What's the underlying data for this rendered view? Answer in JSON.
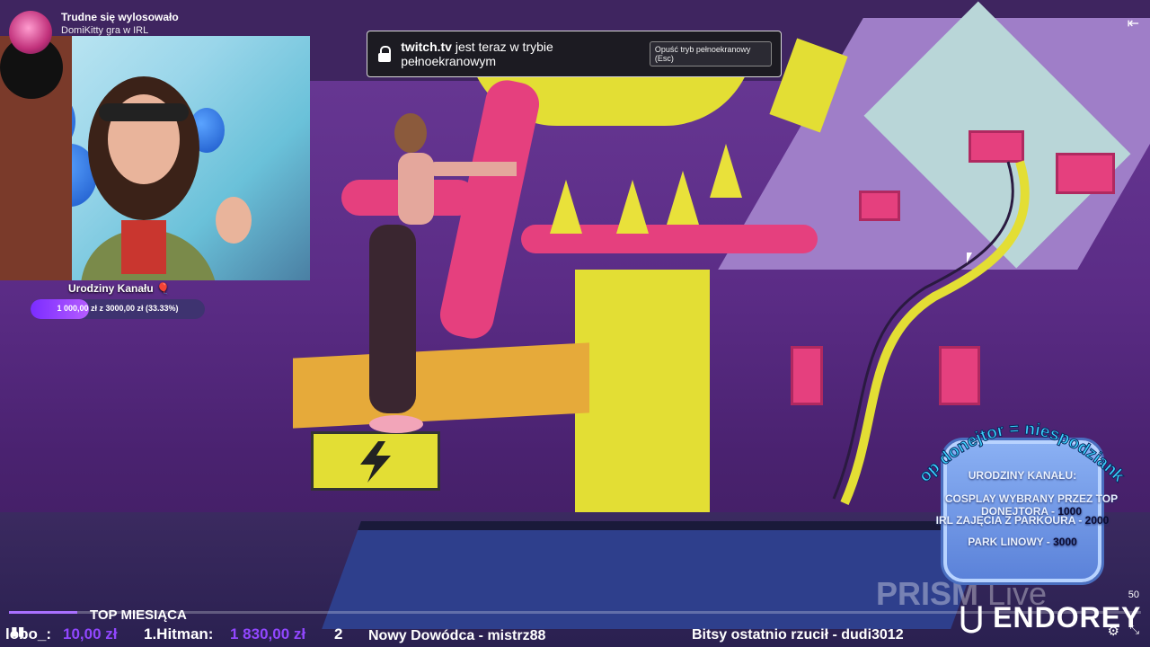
{
  "stream": {
    "title": "Trudne się wylosowało",
    "subtitle": "DomiKitty gra w IRL"
  },
  "goal": {
    "label": "Urodziny Kanału 🎈",
    "text": "1 000,00 zł z 3000,00 zł (33.33%)",
    "progress": 0.3333
  },
  "fullscreen_notice": {
    "domain": "twitch.tv",
    "message": "jest teraz w trybie pełnoekranowym",
    "exit_button": "Opuść tryb pełnoekranowy (Esc)"
  },
  "donation_overlay": {
    "arc_text": "Top donejtor = niespodzianka",
    "heading": "URODZINY KANAŁU:",
    "items": [
      {
        "label": "COSPLAY WYBRANY PRZEZ TOP DONEJTORA - ",
        "amount": "1000"
      },
      {
        "label": "IRL ZAJĘCIA Z PARKOURA - ",
        "amount": "2000"
      },
      {
        "label": "PARK LINOWY - ",
        "amount": "3000"
      }
    ]
  },
  "ticker": {
    "top_label": "TOP MIESIĄCA",
    "entry1_name": "lobo_:",
    "entry1_amount": "10,00 zł",
    "entry2_name": "1.Hitman:",
    "entry2_amount": "1 830,00 zł",
    "entry3_rank": "2",
    "commander": "Nowy Dowódca - mistrz88",
    "bits": "Bitsy ostatnio rzucił - dudi3012"
  },
  "branding": {
    "sponsor": "ENDOREY",
    "prism_main": "PRISM",
    "prism_sub": "Live"
  },
  "player": {
    "volume_value": "50"
  },
  "icons": {
    "exit": "exit-fullscreen-arrow-icon",
    "settings": "gear-icon",
    "fullscreen": "fullscreen-icon",
    "play": "play-bars-icon"
  }
}
